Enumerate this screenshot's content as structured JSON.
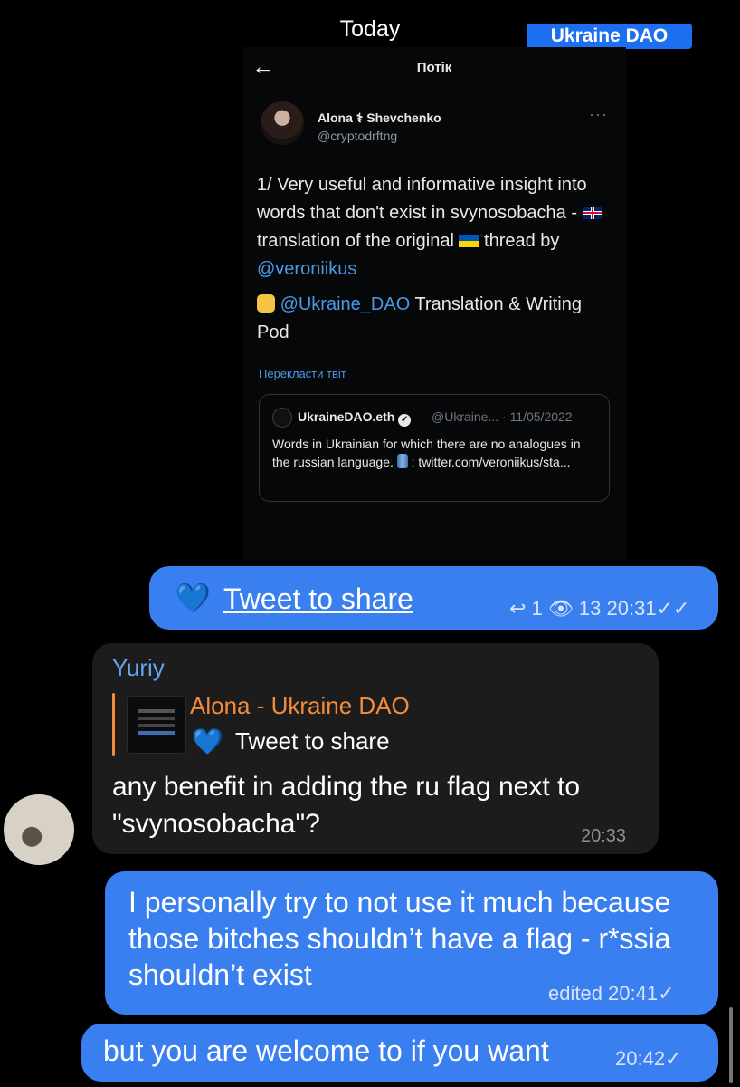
{
  "date_label": "Today",
  "badge": "Ukraine DAO",
  "tweet": {
    "header_title": "Потік",
    "author_name": "Alona ⚕ Shevchenko",
    "author_handle": "@cryptodrftng",
    "more": "···",
    "body": {
      "p1_a": "1/ Very useful and informative insight into words that don't exist in svynosobacha - ",
      "p1_b": " translation of the original ",
      "p1_c": " thread by ",
      "p1_link": "@veroniikus",
      "p2_link": "@Ukraine_DAO",
      "p2_text": " Translation & Writing Pod"
    },
    "translate_link": "Перекласти твіт",
    "quote": {
      "name": "UkraineDAO.eth",
      "meta": "@Ukraine... · 11/05/2022",
      "text_a": "Words in Ukrainian for which there are no analogues in the russian language. ",
      "text_b": " : twitter.com/veroniikus/sta..."
    }
  },
  "messages": {
    "m1": {
      "heart": "💙",
      "link": "Tweet to share",
      "meta": "↩ 1 👁 13 20:31✓✓"
    },
    "m2": {
      "sender": "Yuriy",
      "reply_author": "Alona - Ukraine DAO",
      "reply_heart": "💙",
      "reply_text": "Tweet to share",
      "text": "any benefit in adding the ru flag next to \"svynosobacha\"?",
      "time": "20:33"
    },
    "m3": {
      "text": "I personally try to not use it much because those bitches shouldn’t have a flag - r*ssia shouldn’t exist",
      "meta": "edited 20:41✓"
    },
    "m4": {
      "text": "but you are welcome to if you want",
      "meta": "20:42✓"
    }
  },
  "colors": {
    "outgoing_bubble": "#3a7ff0",
    "incoming_bubble": "#1c1c1d",
    "sender_name": "#62a6f0",
    "reply_accent": "#f28c3b",
    "link": "#4a99e9",
    "badge": "#1d6ff2"
  },
  "icons": [
    "back-arrow-icon",
    "verified-icon",
    "heart-icon",
    "reply-icon",
    "eye-icon",
    "double-check-icon",
    "check-icon"
  ]
}
